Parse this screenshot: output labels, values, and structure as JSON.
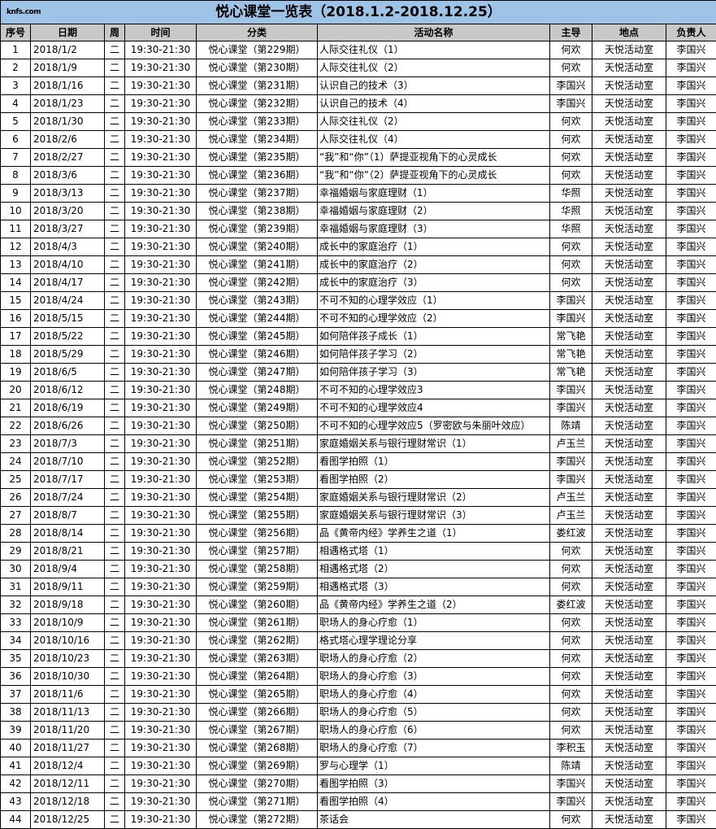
{
  "logo_text": "knfs.com",
  "title": "悦心课堂一览表（2018.1.2-2018.12.25）",
  "columns": [
    "序号",
    "日期",
    "周",
    "时间",
    "分类",
    "活动名称",
    "主导",
    "地点",
    "负责人"
  ],
  "rows": [
    [
      "1",
      "2018/1/2",
      "二",
      "19:30-21:30",
      "悦心课堂（第229期）",
      "人际交往礼仪（1）",
      "何欢",
      "天悦活动室",
      "李国兴"
    ],
    [
      "2",
      "2018/1/9",
      "二",
      "19:30-21:30",
      "悦心课堂（第230期）",
      "人际交往礼仪（2）",
      "何欢",
      "天悦活动室",
      "李国兴"
    ],
    [
      "3",
      "2018/1/16",
      "二",
      "19:30-21:30",
      "悦心课堂（第231期）",
      "认识自己的技术（3）",
      "李国兴",
      "天悦活动室",
      "李国兴"
    ],
    [
      "4",
      "2018/1/23",
      "二",
      "19:30-21:30",
      "悦心课堂（第232期）",
      "认识自己的技术（4）",
      "李国兴",
      "天悦活动室",
      "李国兴"
    ],
    [
      "5",
      "2018/1/30",
      "二",
      "19:30-21:30",
      "悦心课堂（第233期）",
      "人际交往礼仪（2）",
      "何欢",
      "天悦活动室",
      "李国兴"
    ],
    [
      "6",
      "2018/2/6",
      "二",
      "19:30-21:30",
      "悦心课堂（第234期）",
      "人际交往礼仪（4）",
      "何欢",
      "天悦活动室",
      "李国兴"
    ],
    [
      "7",
      "2018/2/27",
      "二",
      "19:30-21:30",
      "悦心课堂（第235期）",
      "“我”和“你”（1）萨提亚视角下的心灵成长",
      "何欢",
      "天悦活动室",
      "李国兴"
    ],
    [
      "8",
      "2018/3/6",
      "二",
      "19:30-21:30",
      "悦心课堂（第236期）",
      "“我”和“你”（2）萨提亚视角下的心灵成长",
      "何欢",
      "天悦活动室",
      "李国兴"
    ],
    [
      "9",
      "2018/3/13",
      "二",
      "19:30-21:30",
      "悦心课堂（第237期）",
      "幸福婚姻与家庭理财（1）",
      "华照",
      "天悦活动室",
      "李国兴"
    ],
    [
      "10",
      "2018/3/20",
      "二",
      "19:30-21:30",
      "悦心课堂（第238期）",
      "幸福婚姻与家庭理财（2）",
      "华照",
      "天悦活动室",
      "李国兴"
    ],
    [
      "11",
      "2018/3/27",
      "二",
      "19:30-21:30",
      "悦心课堂（第239期）",
      "幸福婚姻与家庭理财（3）",
      "华照",
      "天悦活动室",
      "李国兴"
    ],
    [
      "12",
      "2018/4/3",
      "二",
      "19:30-21:30",
      "悦心课堂（第240期）",
      "成长中的家庭治疗（1）",
      "何欢",
      "天悦活动室",
      "李国兴"
    ],
    [
      "13",
      "2018/4/10",
      "二",
      "19:30-21:30",
      "悦心课堂（第241期）",
      "成长中的家庭治疗（2）",
      "何欢",
      "天悦活动室",
      "李国兴"
    ],
    [
      "14",
      "2018/4/17",
      "二",
      "19:30-21:30",
      "悦心课堂（第242期）",
      "成长中的家庭治疗（3）",
      "何欢",
      "天悦活动室",
      "李国兴"
    ],
    [
      "15",
      "2018/4/24",
      "二",
      "19:30-21:30",
      "悦心课堂（第243期）",
      "不可不知的心理学效应（1）",
      "李国兴",
      "天悦活动室",
      "李国兴"
    ],
    [
      "16",
      "2018/5/15",
      "二",
      "19:30-21:30",
      "悦心课堂（第244期）",
      "不可不知的心理学效应（2）",
      "李国兴",
      "天悦活动室",
      "李国兴"
    ],
    [
      "17",
      "2018/5/22",
      "二",
      "19:30-21:30",
      "悦心课堂（第245期）",
      "如何陪伴孩子成长（1）",
      "常飞艳",
      "天悦活动室",
      "李国兴"
    ],
    [
      "18",
      "2018/5/29",
      "二",
      "19:30-21:30",
      "悦心课堂（第246期）",
      "如何陪伴孩子学习（2）",
      "常飞艳",
      "天悦活动室",
      "李国兴"
    ],
    [
      "19",
      "2018/6/5",
      "二",
      "19:30-21:30",
      "悦心课堂（第247期）",
      "如何陪伴孩子学习（3）",
      "常飞艳",
      "天悦活动室",
      "李国兴"
    ],
    [
      "20",
      "2018/6/12",
      "二",
      "19:30-21:30",
      "悦心课堂（第248期）",
      "不可不知的心理学效应3",
      "李国兴",
      "天悦活动室",
      "李国兴"
    ],
    [
      "21",
      "2018/6/19",
      "二",
      "19:30-21:30",
      "悦心课堂（第249期）",
      "不可不知的心理学效应4",
      "李国兴",
      "天悦活动室",
      "李国兴"
    ],
    [
      "22",
      "2018/6/26",
      "二",
      "19:30-21:30",
      "悦心课堂（第250期）",
      "不可不知的心理学效应5（罗密欧与朱丽叶效应）",
      "陈靖",
      "天悦活动室",
      "李国兴"
    ],
    [
      "23",
      "2018/7/3",
      "二",
      "19:30-21:30",
      "悦心课堂（第251期）",
      "家庭婚姻关系与银行理财常识（1）",
      "卢玉兰",
      "天悦活动室",
      "李国兴"
    ],
    [
      "24",
      "2018/7/10",
      "二",
      "19:30-21:30",
      "悦心课堂（第252期）",
      "看图学拍照（1）",
      "李国兴",
      "天悦活动室",
      "李国兴"
    ],
    [
      "25",
      "2018/7/17",
      "二",
      "19:30-21:30",
      "悦心课堂（第253期）",
      "看图学拍照（2）",
      "李国兴",
      "天悦活动室",
      "李国兴"
    ],
    [
      "26",
      "2018/7/24",
      "二",
      "19:30-21:30",
      "悦心课堂（第254期）",
      "家庭婚姻关系与银行理财常识（2）",
      "卢玉兰",
      "天悦活动室",
      "李国兴"
    ],
    [
      "27",
      "2018/8/7",
      "二",
      "19:30-21:30",
      "悦心课堂（第255期）",
      "家庭婚姻关系与银行理财常识（3）",
      "卢玉兰",
      "天悦活动室",
      "李国兴"
    ],
    [
      "28",
      "2018/8/14",
      "二",
      "19:30-21:30",
      "悦心课堂（第256期）",
      "品《黄帝内经》学养生之道（1）",
      "娄红波",
      "天悦活动室",
      "李国兴"
    ],
    [
      "29",
      "2018/8/21",
      "二",
      "19:30-21:30",
      "悦心课堂（第257期）",
      "相遇格式塔（1）",
      "何欢",
      "天悦活动室",
      "李国兴"
    ],
    [
      "30",
      "2018/9/4",
      "二",
      "19:30-21:30",
      "悦心课堂（第258期）",
      "相遇格式塔（2）",
      "何欢",
      "天悦活动室",
      "李国兴"
    ],
    [
      "31",
      "2018/9/11",
      "二",
      "19:30-21:30",
      "悦心课堂（第259期）",
      "相遇格式塔（3）",
      "何欢",
      "天悦活动室",
      "李国兴"
    ],
    [
      "32",
      "2018/9/18",
      "二",
      "19:30-21:30",
      "悦心课堂（第260期）",
      "品《黄帝内经》学养生之道（2）",
      "娄红波",
      "天悦活动室",
      "李国兴"
    ],
    [
      "33",
      "2018/10/9",
      "二",
      "19:30-21:30",
      "悦心课堂（第261期）",
      "职场人的身心疗愈（1）",
      "何欢",
      "天悦活动室",
      "李国兴"
    ],
    [
      "34",
      "2018/10/16",
      "二",
      "19:30-21:30",
      "悦心课堂（第262期）",
      "格式塔心理学理论分享",
      "何欢",
      "天悦活动室",
      "李国兴"
    ],
    [
      "35",
      "2018/10/23",
      "二",
      "19:30-21:30",
      "悦心课堂（第263期）",
      "职场人的身心疗愈（2）",
      "何欢",
      "天悦活动室",
      "李国兴"
    ],
    [
      "36",
      "2018/10/30",
      "二",
      "19:30-21:30",
      "悦心课堂（第264期）",
      "职场人的身心疗愈（3）",
      "何欢",
      "天悦活动室",
      "李国兴"
    ],
    [
      "37",
      "2018/11/6",
      "二",
      "19:30-21:30",
      "悦心课堂（第265期）",
      "职场人的身心疗愈（4）",
      "何欢",
      "天悦活动室",
      "李国兴"
    ],
    [
      "38",
      "2018/11/13",
      "二",
      "19:30-21:30",
      "悦心课堂（第266期）",
      "职场人的身心疗愈（5）",
      "何欢",
      "天悦活动室",
      "李国兴"
    ],
    [
      "39",
      "2018/11/20",
      "二",
      "19:30-21:30",
      "悦心课堂（第267期）",
      "职场人的身心疗愈（6）",
      "何欢",
      "天悦活动室",
      "李国兴"
    ],
    [
      "40",
      "2018/11/27",
      "二",
      "19:30-21:30",
      "悦心课堂（第268期）",
      "职场人的身心疗愈（7）",
      "李积玉",
      "天悦活动室",
      "李国兴"
    ],
    [
      "41",
      "2018/12/4",
      "二",
      "19:30-21:30",
      "悦心课堂（第269期）",
      "罗与心理学（1）",
      "陈靖",
      "天悦活动室",
      "李国兴"
    ],
    [
      "42",
      "2018/12/11",
      "二",
      "19:30-21:30",
      "悦心课堂（第270期）",
      "看图学拍照（3）",
      "李国兴",
      "天悦活动室",
      "李国兴"
    ],
    [
      "43",
      "2018/12/18",
      "二",
      "19:30-21:30",
      "悦心课堂（第271期）",
      "看图学拍照（4）",
      "李国兴",
      "天悦活动室",
      "李国兴"
    ],
    [
      "44",
      "2018/12/25",
      "二",
      "19:30-21:30",
      "悦心课堂（第272期）",
      "茶话会",
      "何欢",
      "天悦活动室",
      "李国兴"
    ]
  ]
}
